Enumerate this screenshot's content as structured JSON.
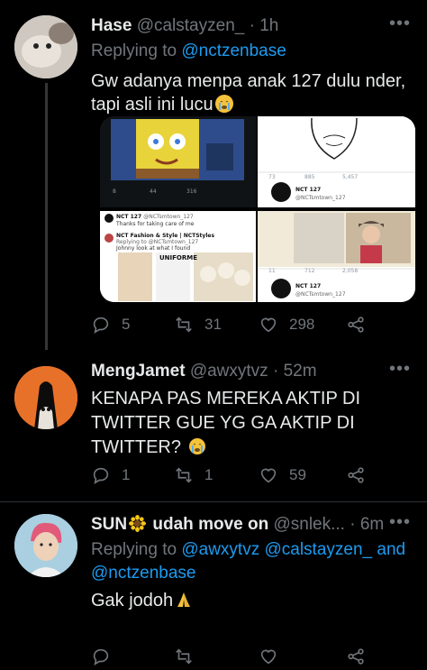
{
  "tweets": [
    {
      "name": "Hase",
      "handle": "@calstayzen_",
      "time": "1h",
      "replying_prefix": "Replying to",
      "replying_to": [
        "@nctzenbase"
      ],
      "text_line1": "Gw adanya menpa anak 127 dulu nder,",
      "text_line2": "tapi asli ini lucu",
      "emoji": "crying-face",
      "actions": {
        "replies": "5",
        "retweets": "31",
        "likes": "298"
      },
      "media": {
        "img1": {
          "counts": [
            "8",
            "44",
            "316"
          ]
        },
        "img2": {
          "counts": [
            "73",
            "885",
            "5,457"
          ],
          "account_name": "NCT 127",
          "account_handle": "@NCTsmtown_127"
        },
        "img3": {
          "account_name": "NCT 127",
          "account_handle": "@NCTsmtown_127",
          "line1": "Thanks for taking care of me",
          "line2": "NCT Fashion & Style | NCTStyles",
          "line3": "Replying to @NCTsmtown_127",
          "line4": "Johnny look at what I found",
          "label": "UNIFORME"
        },
        "img4": {
          "counts": [
            "11",
            "712",
            "2,058"
          ],
          "account_name": "NCT 127",
          "account_handle": "@NCTsmtown_127"
        }
      }
    },
    {
      "name": "MengJamet",
      "handle": "@awxytvz",
      "time": "52m",
      "text_line1": "KENAPA PAS MEREKA AKTIP DI",
      "text_line2": "TWITTER GUE YG GA AKTIP DI",
      "text_line3": "TWITTER?",
      "emoji": "crying-face",
      "actions": {
        "replies": "1",
        "retweets": "1",
        "likes": "59"
      }
    },
    {
      "name": "SUN",
      "name_emoji": "sunflower",
      "name_rest": "udah move on",
      "handle": "@snlek...",
      "time": "6m",
      "replying_prefix": "Replying to",
      "replying_to_line1": "@awxytvz @calstayzen_ and",
      "replying_to_line2": "@nctzenbase",
      "text_line1": "Gak jodoh",
      "emoji": "folded-hands"
    }
  ],
  "colors": {
    "background": "#000000",
    "text": "#e7e9ea",
    "muted": "#71767b",
    "link": "#1d9bf0"
  }
}
